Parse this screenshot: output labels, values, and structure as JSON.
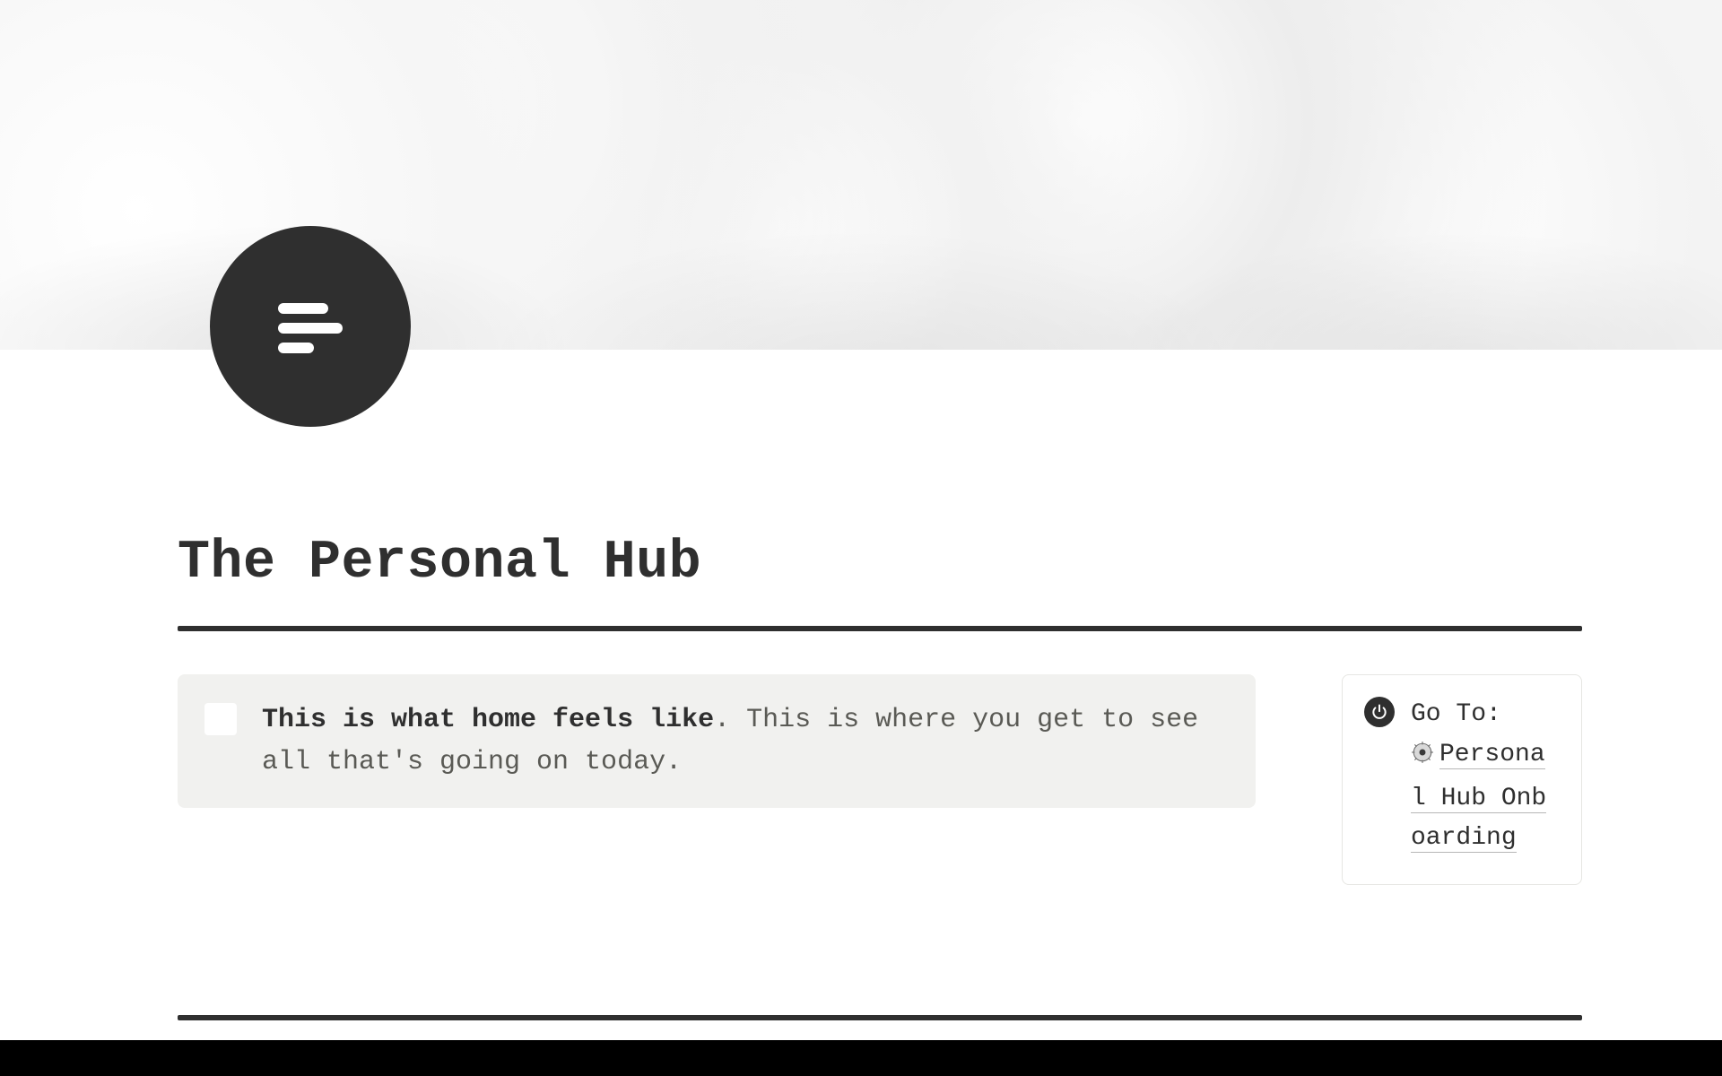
{
  "page": {
    "title": "The Personal Hub",
    "callout": {
      "bold": "This is what home feels like",
      "rest": ". This is where you get to see all that's going on today."
    },
    "goto": {
      "label": "Go To:",
      "link_text": "Personal Hub Onboarding"
    }
  }
}
